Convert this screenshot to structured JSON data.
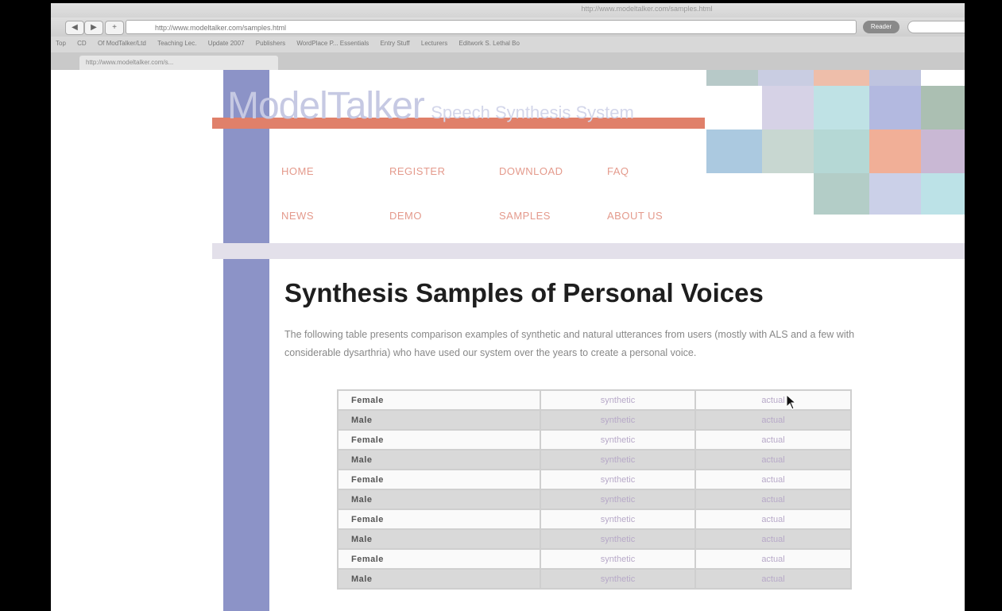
{
  "browser": {
    "tab_url": "http://www.modeltalker.com/samples.html",
    "nav": {
      "back": "◀",
      "forward": "▶",
      "add": "+"
    },
    "address": "http://www.modeltalker.com/samples.html",
    "reader_label": "Reader",
    "search_placeholder": "",
    "bookmarks": [
      "Top",
      "CD",
      "Of ModTalker/Ltd",
      "Teaching Lec.",
      "Update 2007",
      "Publishers",
      "WordPlace P... Essentials",
      "Entry Stuff",
      "Lecturers",
      "Editwork S. Lethal Bo"
    ],
    "active_tab_title": "http://www.modeltalker.com/s..."
  },
  "site": {
    "logo_main": "ModelTalker",
    "logo_sub": "Speech Synthesis System",
    "nav": [
      "HOME",
      "REGISTER",
      "DOWNLOAD",
      "FAQ",
      "NEWS",
      "DEMO",
      "SAMPLES",
      "ABOUT US"
    ]
  },
  "content": {
    "title": "Synthesis Samples of Personal Voices",
    "intro": "The following table presents comparison examples of synthetic and natural utterances from users (mostly with ALS and a few with considerable dysarthria) who have used our system over the years to create a personal voice.",
    "rows": [
      {
        "gender": "Female",
        "synthetic": "synthetic",
        "actual": "actual"
      },
      {
        "gender": "Male",
        "synthetic": "synthetic",
        "actual": "actual"
      },
      {
        "gender": "Female",
        "synthetic": "synthetic",
        "actual": "actual"
      },
      {
        "gender": "Male",
        "synthetic": "synthetic",
        "actual": "actual"
      },
      {
        "gender": "Female",
        "synthetic": "synthetic",
        "actual": "actual"
      },
      {
        "gender": "Male",
        "synthetic": "synthetic",
        "actual": "actual"
      },
      {
        "gender": "Female",
        "synthetic": "synthetic",
        "actual": "actual"
      },
      {
        "gender": "Male",
        "synthetic": "synthetic",
        "actual": "actual"
      },
      {
        "gender": "Female",
        "synthetic": "synthetic",
        "actual": "actual"
      },
      {
        "gender": "Male",
        "synthetic": "synthetic",
        "actual": "actual"
      }
    ]
  },
  "colors": {
    "left_bar": "#8c93c7",
    "header_band": "#e0806a",
    "nav_text": "#e49a8c",
    "separator": "#e3e0ea"
  },
  "icons": {
    "cursor": "arrow-cursor-icon"
  }
}
